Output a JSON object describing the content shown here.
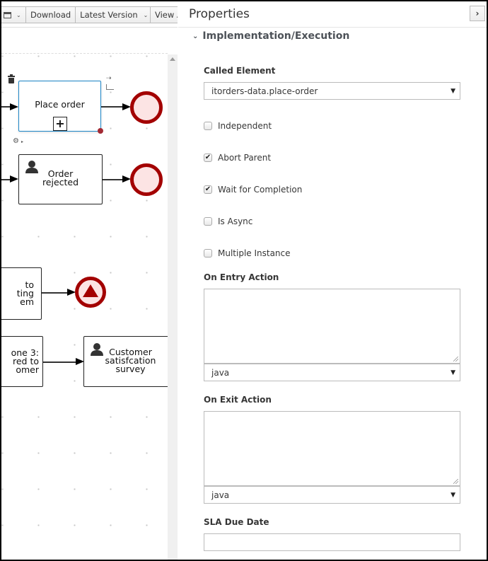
{
  "toolbar": {
    "view_icon": "window-icon",
    "download_label": "Download",
    "version_label": "Latest Version",
    "view_alerts_label": "View A"
  },
  "diagram": {
    "tasks": [
      {
        "id": "place-order",
        "label": "Place order",
        "type": "reusable-subprocess",
        "selected": true
      },
      {
        "id": "order-rejected",
        "label": "Order\nrejected",
        "type": "user-task"
      },
      {
        "id": "to-ting-em",
        "label": "to\nting\nem",
        "type": "task"
      },
      {
        "id": "milestone-3",
        "label": "one 3:\nred to\nomer",
        "type": "task"
      },
      {
        "id": "customer-survey",
        "label": "Customer\nsatisfcation\nsurvey",
        "type": "user-task"
      }
    ],
    "end_events": [
      {
        "id": "end-1",
        "type": "end"
      },
      {
        "id": "end-2",
        "type": "end"
      },
      {
        "id": "end-3",
        "type": "escalation-end"
      }
    ],
    "colors": {
      "event_border": "#a30000",
      "event_fill": "#fce4e4",
      "selection": "#1e87c8"
    }
  },
  "properties": {
    "title": "Properties",
    "collapse_icon": "chevron-right-icon",
    "section": "Implementation/Execution",
    "called_element_label": "Called Element",
    "called_element_value": "itorders-data.place-order",
    "checkboxes": [
      {
        "label": "Independent",
        "checked": false
      },
      {
        "label": "Abort Parent",
        "checked": true
      },
      {
        "label": "Wait for Completion",
        "checked": true
      },
      {
        "label": "Is Async",
        "checked": false
      },
      {
        "label": "Multiple Instance",
        "checked": false
      }
    ],
    "on_entry_label": "On Entry Action",
    "on_entry_value": "",
    "on_entry_language": "java",
    "on_exit_label": "On Exit Action",
    "on_exit_value": "",
    "on_exit_language": "java",
    "sla_label": "SLA Due Date",
    "sla_value": ""
  }
}
